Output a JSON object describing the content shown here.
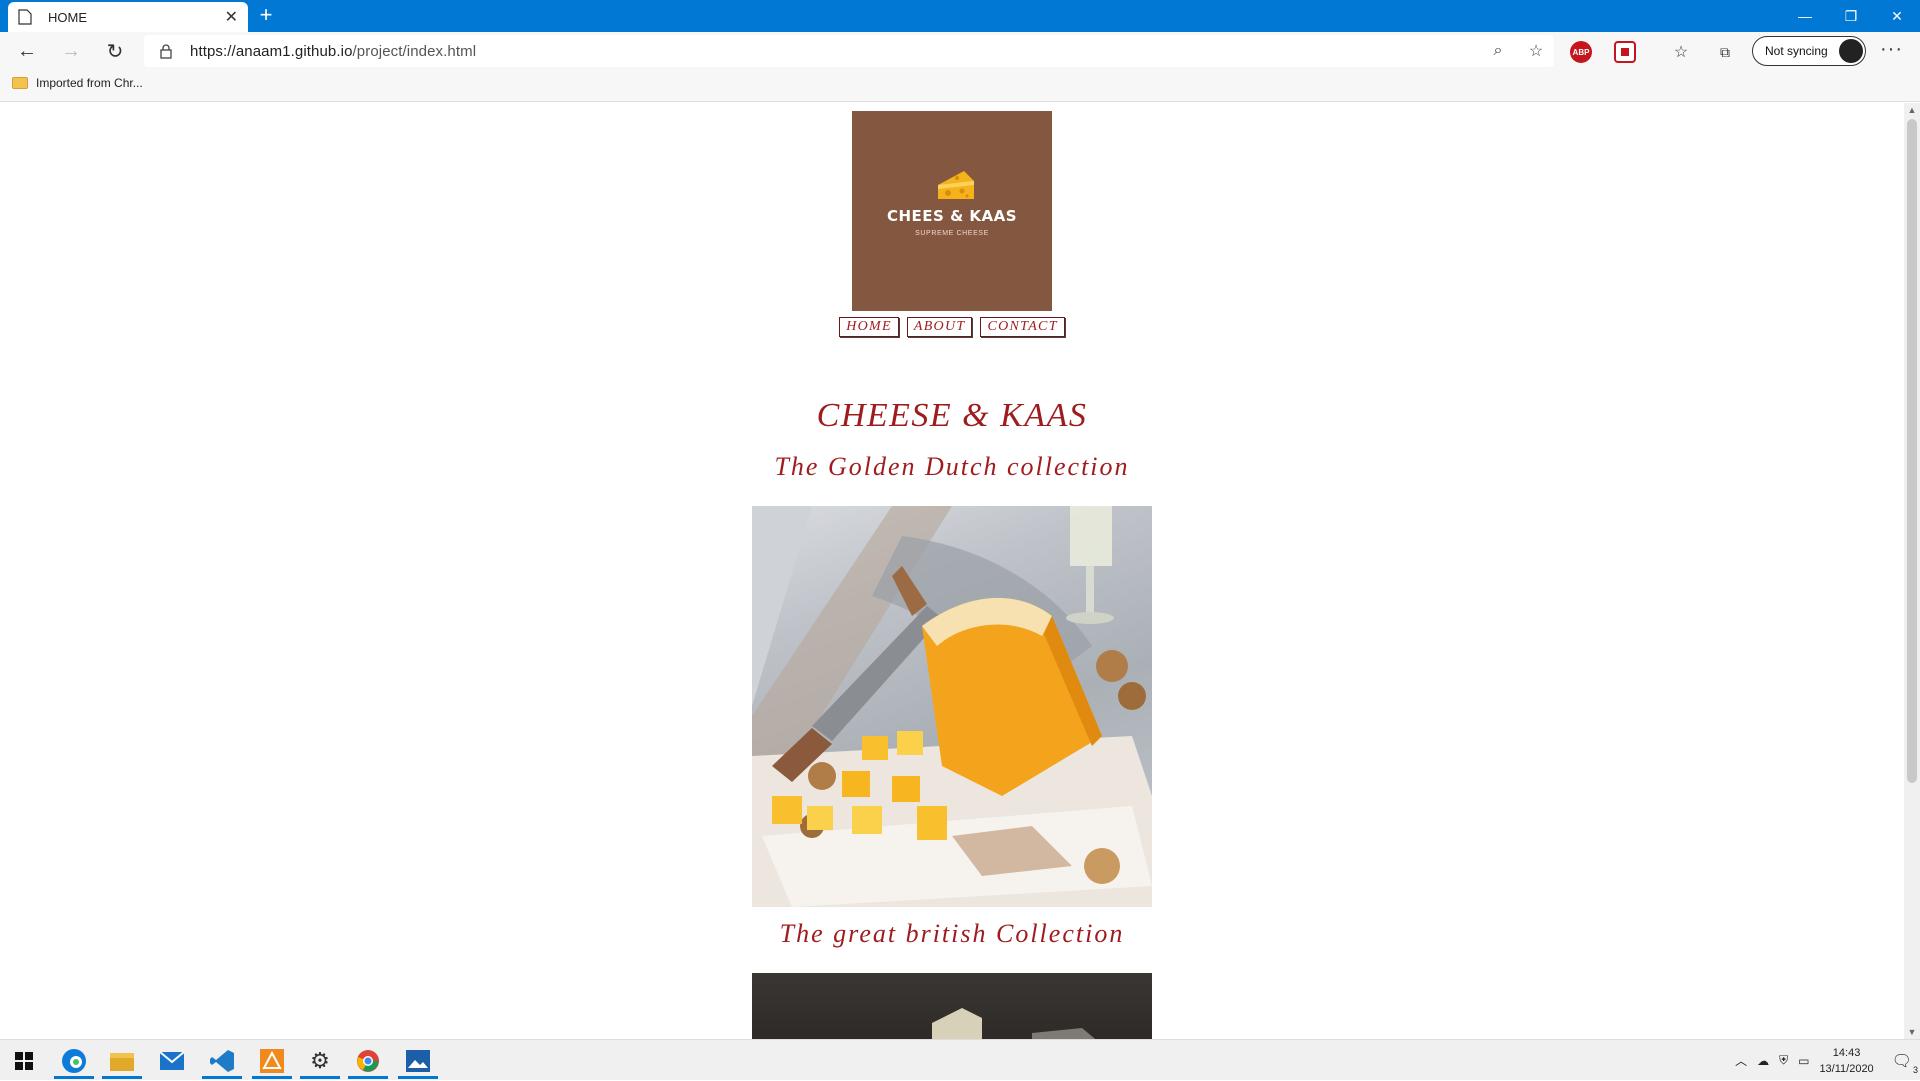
{
  "browser": {
    "tab_title": "HOME",
    "url_host": "https://anaam1.github.io",
    "url_path": "/project/index.html",
    "sync_label": "Not syncing",
    "bookmark_label": "Imported from Chr..."
  },
  "site": {
    "logo_brand": "CHEES & KAAS",
    "logo_tagline": "SUPREME CHEESE",
    "nav": [
      "HOME",
      "ABOUT",
      "CONTACT"
    ],
    "heading": "CHEESE & KAAS",
    "collection1": "The Golden Dutch collection",
    "collection2": "The great british Collection"
  },
  "system": {
    "time": "14:43",
    "date": "13/11/2020",
    "notifications": "3"
  },
  "colors": {
    "accent": "#0078d4",
    "site_red": "#9e1b1e",
    "logo_brown": "#845741"
  }
}
